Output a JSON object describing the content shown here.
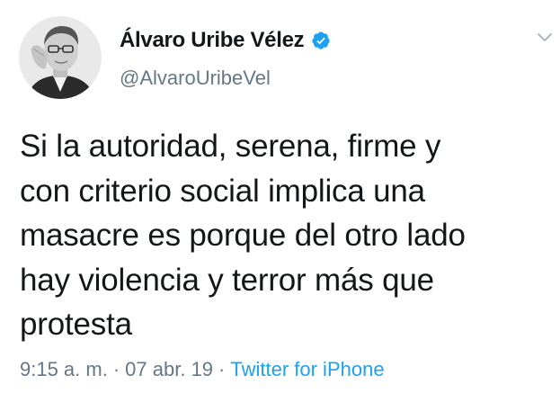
{
  "author": {
    "display_name": "Álvaro Uribe Vélez",
    "handle": "@AlvaroUribeVel",
    "verified": true,
    "avatar_icon": "profile-photo"
  },
  "tweet": {
    "text": "Si la autoridad, serena, firme y\ncon criterio social implica una\nmasacre es porque del otro lado\nhay violencia y terror más que\nprotesta"
  },
  "meta": {
    "time": "9:15 a. m.",
    "separator": "·",
    "date": "07 abr. 19",
    "source": "Twitter for iPhone"
  },
  "colors": {
    "text": "#14171a",
    "secondary": "#657786",
    "accent": "#1da1f2"
  },
  "icons": {
    "verified": "verified-badge-icon",
    "more": "chevron-down-icon"
  }
}
